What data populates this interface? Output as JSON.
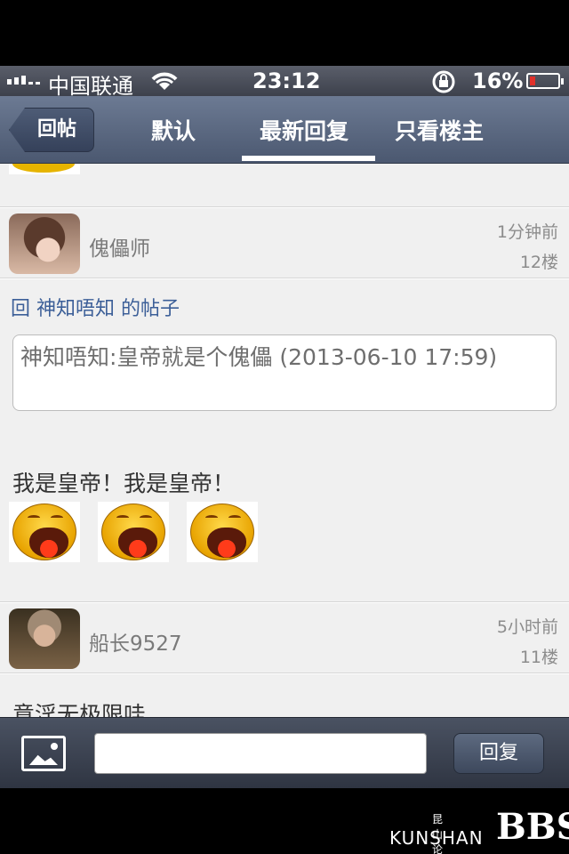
{
  "status_bar": {
    "carrier": "中国联通",
    "time": "23:12",
    "battery_percent": "16%",
    "battery_level": 0.16,
    "icons": [
      "signal-icon",
      "wifi-icon",
      "rotation-lock-icon",
      "battery-icon"
    ]
  },
  "nav": {
    "back_label": "回帖",
    "tabs": [
      {
        "label": "默认"
      },
      {
        "label": "最新回复",
        "selected": true
      },
      {
        "label": "只看楼主"
      }
    ]
  },
  "posts": [
    {
      "username": "傀儡师",
      "time_ago": "1分钟前",
      "floor": "12楼",
      "reply_to": "回 神知唔知 的帖子",
      "quote": "神知唔知:皇帝就是个傀儡 (2013-06-10 17:59)",
      "body": "我是皇帝！我是皇帝！",
      "emoji_count": 3,
      "emoji_icon": "laughing-face-icon"
    },
    {
      "username": "船长9527",
      "time_ago": "5小时前",
      "floor": "11楼",
      "body": "意淫无极限哇"
    }
  ],
  "toolbar": {
    "image_icon": "image-icon",
    "reply_input_value": "",
    "reply_button_label": "回复"
  },
  "watermark": {
    "cn": "昆山论坛",
    "en": "KUNSHAN",
    "bbs": "BBS"
  }
}
